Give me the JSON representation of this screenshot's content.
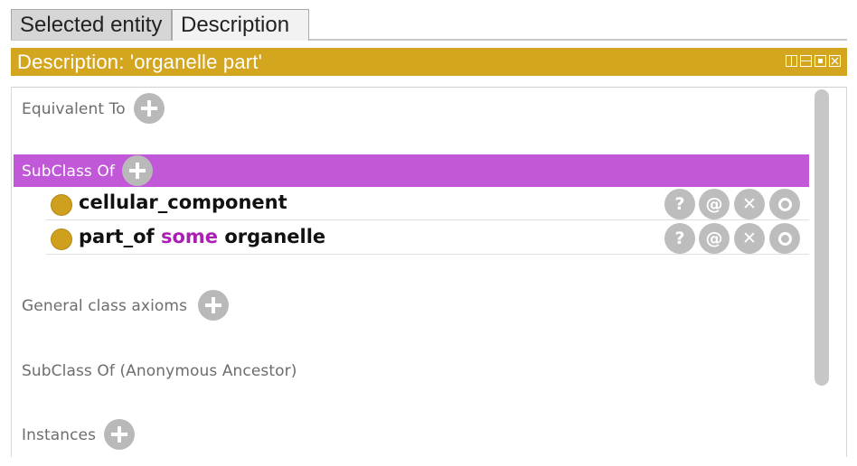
{
  "tabs": [
    {
      "label": "Selected entity"
    },
    {
      "label": "Description"
    }
  ],
  "title_bar": {
    "title": "Description: 'organelle part'",
    "color": "#d4a620"
  },
  "sections": {
    "equivalent_to": "Equivalent To",
    "subclass_of": "SubClass Of",
    "general_class_axioms": "General class axioms",
    "subclass_of_anon": "SubClass Of (Anonymous Ancestor)",
    "instances": "Instances"
  },
  "subclass_axioms": [
    {
      "text": "cellular_component"
    },
    {
      "prefix": "part_of",
      "keyword": "some",
      "suffix": "organelle"
    }
  ],
  "row_buttons": {
    "explain": "?",
    "annotate": "@",
    "delete": "✕"
  },
  "colors": {
    "subclass_header": "#c158d8",
    "keyword": "#ab1fb2",
    "class_dot": "#cf9f1e"
  }
}
